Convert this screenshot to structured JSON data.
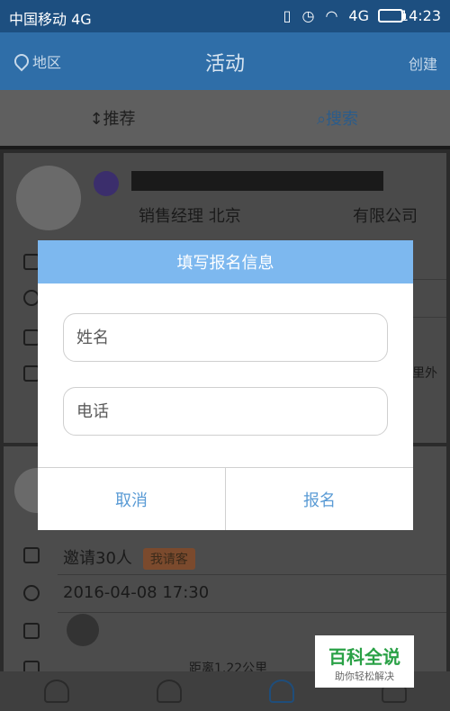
{
  "statusbar": {
    "carrier": "中国移动 4G",
    "signal": "4G",
    "time": "14:23"
  },
  "header": {
    "region": "地区",
    "title": "活动",
    "create": "创建"
  },
  "tabs": [
    {
      "label": "↕推荐"
    },
    {
      "label": "⌕搜索"
    }
  ],
  "card1": {
    "job": "销售经理 北京",
    "company": "有限公司",
    "distance_suffix": "里外"
  },
  "card2": {
    "invite": "邀请30人",
    "tag": "我请客",
    "datetime": "2016-04-08 17:30",
    "distance": "距离1.22公里"
  },
  "dialog": {
    "title": "填写报名信息",
    "name_placeholder": "姓名",
    "phone_placeholder": "电话",
    "cancel_label": "取消",
    "submit_label": "报名"
  },
  "watermark": {
    "title": "百科全说",
    "subtitle": "助你轻松解决"
  },
  "colors": {
    "dialog_header": "#7db8ef",
    "button_text": "#5a9bd5",
    "header_bg": "#2f6ea8"
  }
}
